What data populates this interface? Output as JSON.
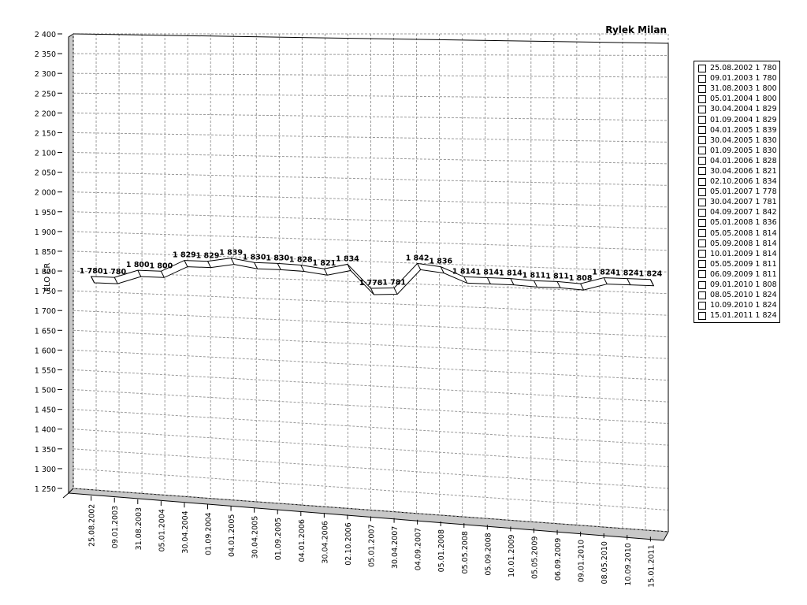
{
  "chart_data": {
    "type": "line",
    "title": "Rylek Milan",
    "ylabel": "ELO ČR",
    "xlabel": "",
    "ylim": [
      1250,
      2400
    ],
    "yticks": [
      "2 400",
      "2 350",
      "2 300",
      "2 250",
      "2 200",
      "2 150",
      "2 100",
      "2 050",
      "2 000",
      "1 950",
      "1 900",
      "1 850",
      "1 800",
      "1 750",
      "1 700",
      "1 650",
      "1 600",
      "1 550",
      "1 500",
      "1 450",
      "1 400",
      "1 350",
      "1 300",
      "1 250"
    ],
    "grid": true,
    "legend_position": "right",
    "categories": [
      "25.08.2002",
      "09.01.2003",
      "31.08.2003",
      "05.01.2004",
      "30.04.2004",
      "01.09.2004",
      "04.01.2005",
      "30.04.2005",
      "01.09.2005",
      "04.01.2006",
      "30.04.2006",
      "02.10.2006",
      "05.01.2007",
      "30.04.2007",
      "04.09.2007",
      "05.01.2008",
      "05.05.2008",
      "05.09.2008",
      "10.01.2009",
      "05.05.2009",
      "06.09.2009",
      "09.01.2010",
      "08.05.2010",
      "10.09.2010",
      "15.01.2011"
    ],
    "values": [
      1780,
      1780,
      1800,
      1800,
      1829,
      1829,
      1839,
      1830,
      1830,
      1828,
      1821,
      1834,
      1778,
      1781,
      1842,
      1836,
      1814,
      1814,
      1814,
      1811,
      1811,
      1808,
      1824,
      1824,
      1824
    ],
    "value_labels": [
      "1 780",
      "1 780",
      "1 800",
      "1 800",
      "1 829",
      "1 829",
      "1 839",
      "1 830",
      "1 830",
      "1 828",
      "1 821",
      "1 834",
      "1 778",
      "1 781",
      "1 842",
      "1 836",
      "1 814",
      "1 814",
      "1 814",
      "1 811",
      "1 811",
      "1 808",
      "1 824",
      "1 824",
      "1 824"
    ],
    "legend": [
      "25.08.2002 1 780",
      "09.01.2003 1 780",
      "31.08.2003 1 800",
      "05.01.2004 1 800",
      "30.04.2004 1 829",
      "01.09.2004 1 829",
      "04.01.2005 1 839",
      "30.04.2005 1 830",
      "01.09.2005 1 830",
      "04.01.2006 1 828",
      "30.04.2006 1 821",
      "02.10.2006 1 834",
      "05.01.2007 1 778",
      "30.04.2007 1 781",
      "04.09.2007 1 842",
      "05.01.2008 1 836",
      "05.05.2008 1 814",
      "05.09.2008 1 814",
      "10.01.2009 1 814",
      "05.05.2009 1 811",
      "06.09.2009 1 811",
      "09.01.2010 1 808",
      "08.05.2010 1 824",
      "10.09.2010 1 824",
      "15.01.2011 1 824"
    ],
    "colors": {
      "line_fill": "#ffffff",
      "line_stroke": "#000000",
      "wall": "#c8c8c8",
      "grid": "#9a9a9a"
    }
  }
}
